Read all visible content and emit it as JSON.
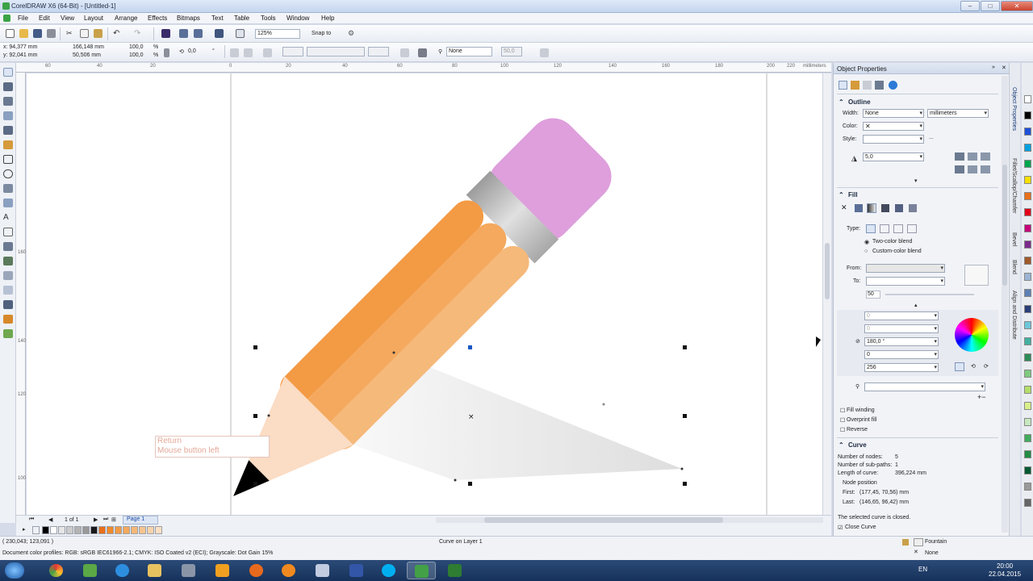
{
  "window": {
    "title": "CorelDRAW X6 (64-Bit) - [Untitled-1]",
    "minimize": "–",
    "maximize": "□",
    "close": "✕"
  },
  "menu": [
    "File",
    "Edit",
    "View",
    "Layout",
    "Arrange",
    "Effects",
    "Bitmaps",
    "Text",
    "Table",
    "Tools",
    "Window",
    "Help"
  ],
  "toolbar1": {
    "zoom": "125%",
    "snap_to": "Snap to"
  },
  "toolbar2": {
    "x": "x: 94,377 mm",
    "y": "y: 92,041 mm",
    "w": "166,148 mm",
    "h": "50,506 mm",
    "scale_w": "100,0",
    "scale_h": "100,0",
    "pct": "%",
    "rotate": "0,0",
    "degree": "°",
    "outline_none": "None",
    "outline_width": "50,0"
  },
  "ruler": {
    "unit": "millimeters",
    "top_ticks": [
      "60",
      "40",
      "20",
      "0",
      "20",
      "40",
      "60",
      "80",
      "100",
      "120",
      "140",
      "160",
      "180",
      "200",
      "220"
    ],
    "left_ticks": [
      "160",
      "140",
      "120",
      "100"
    ]
  },
  "canvas": {
    "hint_line1": "Return",
    "hint_line2": "Mouse button left"
  },
  "pagebar": {
    "count": "1 of 1",
    "page_tab": "Page 1"
  },
  "status": {
    "coords": "( 230,043; 123,091 )",
    "object": "Curve on Layer 1",
    "profiles": "Document color profiles: RGB: sRGB IEC61966-2.1; CMYK: ISO Coated v2 (ECI); Grayscale: Dot Gain 15%",
    "fill_label": "Fountain",
    "outline_label": "None"
  },
  "docker": {
    "title": "Object Properties",
    "outline": {
      "section": "Outline",
      "width_label": "Width:",
      "width_value": "None",
      "unit_value": "millimeters",
      "color_label": "Color:",
      "style_label": "Style:",
      "miter_value": "5,0"
    },
    "fill": {
      "section": "Fill",
      "type_label": "Type:",
      "two_color": "Two-color blend",
      "custom_color": "Custom-color blend",
      "from_label": "From:",
      "to_label": "To:",
      "midpoint": "50",
      "x": "0",
      "y": "0",
      "angle": "180,0 °",
      "edge": "0",
      "steps": "256",
      "fill_winding": "Fill winding",
      "overprint": "Overprint fill",
      "reverse": "Reverse"
    },
    "curve": {
      "section": "Curve",
      "nodes_label": "Number of nodes:",
      "nodes_value": "5",
      "subpaths_label": "Number of sub-paths:",
      "subpaths_value": "1",
      "length_label": "Length of curve:",
      "length_value": "396,224 mm",
      "node_position": "Node position",
      "first_label": "First:",
      "first_value": "(177,45, 70,56) mm",
      "last_label": "Last:",
      "last_value": "(146,65, 96,42) mm",
      "closed_text": "The selected curve is closed.",
      "close_curve": "Close Curve"
    }
  },
  "side_tabs": [
    "Object Properties",
    "Fillet/Scallop/Chamfer",
    "Bevel",
    "Blend",
    "Align and Distribute"
  ],
  "palette_colors": [
    "#000000",
    "#ffffff",
    "#e6e6e6",
    "#cccccc",
    "#b3b3b3",
    "#999999",
    "#1a1a1a",
    "#e8701b",
    "#f08a2c",
    "#f29b46",
    "#f4a95e",
    "#f6b877",
    "#f7c48f",
    "#f9d3ab",
    "#fbe0c4"
  ],
  "right_palette": [
    "#ffffff",
    "#000000",
    "#1f4fd8",
    "#00a0e0",
    "#00a650",
    "#f5e000",
    "#e8701b",
    "#e2001a",
    "#c4007a",
    "#7b2a8c",
    "#a05a2c",
    "#9bb3d4",
    "#5d7fb5",
    "#2b3e78",
    "#6fc6d9",
    "#44b0a0",
    "#2e8b57",
    "#7fc97f",
    "#b3de69",
    "#d9ef8b",
    "#c7e9c0",
    "#41ab5d",
    "#238b45",
    "#005a32",
    "#999999",
    "#666666"
  ],
  "taskbar": {
    "lang": "EN",
    "time": "20:00",
    "date": "22.04.2015"
  }
}
